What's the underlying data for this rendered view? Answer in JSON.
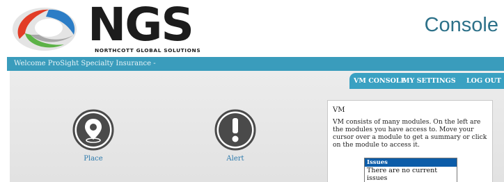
{
  "header": {
    "brand_name": "NGS",
    "brand_tagline": "NORTHCOTT GLOBAL SOLUTIONS",
    "logo_icon": "swirl-logo-icon",
    "app_title": "Console"
  },
  "welcome_bar": {
    "text": "Welcome ProSight Specialty Insurance -"
  },
  "nav": {
    "items": [
      {
        "label": "VM CONSOLE"
      },
      {
        "label": "MY SETTINGS"
      },
      {
        "label": "LOG OUT"
      }
    ]
  },
  "modules": [
    {
      "label": "Place",
      "icon": "map-pin-icon"
    },
    {
      "label": "Alert",
      "icon": "exclamation-icon"
    }
  ],
  "info_panel": {
    "title": "VM",
    "body": "VM consists of many modules. On the left are the modules you have access to. Move your cursor over a module to get a summary or click on the module to access it.",
    "issues": {
      "header": "Issues",
      "message": "There are no current issues"
    }
  },
  "colors": {
    "accent_blue": "#3a9cbc",
    "title_blue": "#2d7189",
    "link_blue": "#2a78ab",
    "issues_header": "#0c5ca8",
    "icon_dark": "#4a4a4a",
    "logo_red": "#e23c26",
    "logo_green": "#5cb247",
    "logo_blue": "#2c7dc6"
  }
}
